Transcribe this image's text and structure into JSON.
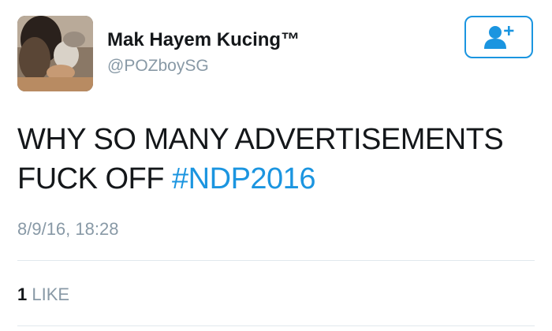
{
  "user": {
    "display_name": "Mak Hayem Kucing™",
    "handle": "@POZboySG",
    "avatar_icon": "profile-photo"
  },
  "follow_button": {
    "icon": "add-user-icon",
    "color": "#1b95e0"
  },
  "tweet": {
    "text": "WHY SO MANY ADVERTISEMENTS FUCK OFF ",
    "hashtag": "#NDP2016",
    "hashtag_color": "#1b95e0"
  },
  "timestamp": "8/9/16, 18:28",
  "stats": {
    "like_count": "1",
    "like_label": "LIKE"
  }
}
